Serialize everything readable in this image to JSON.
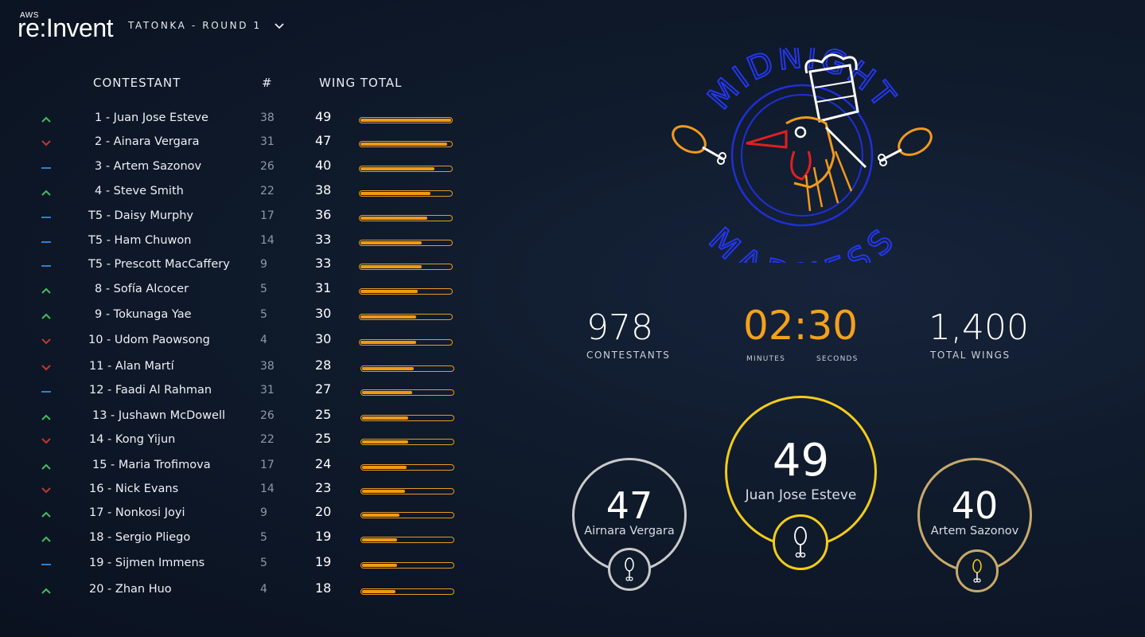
{
  "header": {
    "brand_small": "AWS",
    "brand_main": "re:Invent",
    "round_title": "TATONKA - ROUND 1",
    "dropdown_icon": "chevron-down-icon"
  },
  "table": {
    "headers": {
      "contestant": "CONTESTANT",
      "number": "#",
      "wing_total": "WING TOTAL"
    },
    "max_wings": 49,
    "rows": [
      {
        "trend": "up",
        "name": "1 - Juan Jose Esteve",
        "num": "38",
        "total": "49",
        "value": 49
      },
      {
        "trend": "down",
        "name": "2 - Ainara Vergara",
        "num": "31",
        "total": "47",
        "value": 47
      },
      {
        "trend": "same",
        "name": "3 - Artem Sazonov",
        "num": "26",
        "total": "40",
        "value": 40
      },
      {
        "trend": "up",
        "name": "4 - Steve Smith",
        "num": "22",
        "total": "38",
        "value": 38
      },
      {
        "trend": "same",
        "name": "T5 - Daisy Murphy",
        "num": "17",
        "total": "36",
        "value": 36
      },
      {
        "trend": "same",
        "name": "T5 - Ham Chuwon",
        "num": "14",
        "total": "33",
        "value": 33
      },
      {
        "trend": "same",
        "name": "T5 - Prescott MacCaffery",
        "num": "9",
        "total": "33",
        "value": 33
      },
      {
        "trend": "up",
        "name": "8 - Sofía Alcocer",
        "num": "5",
        "total": "31",
        "value": 31
      },
      {
        "trend": "up",
        "name": "9 - Tokunaga Yae",
        "num": "5",
        "total": "30",
        "value": 30
      },
      {
        "trend": "down",
        "name": "10 - Udom Paowsong",
        "num": "4",
        "total": "30",
        "value": 30
      },
      {
        "trend": "down",
        "name": "11 - Alan Martí",
        "num": "38",
        "total": "28",
        "value": 28
      },
      {
        "trend": "same",
        "name": "12 - Faadi Al Rahman",
        "num": "31",
        "total": "27",
        "value": 27
      },
      {
        "trend": "up",
        "name": "13 - Jushawn McDowell",
        "num": "26",
        "total": "25",
        "value": 25
      },
      {
        "trend": "down",
        "name": "14 - Kong Yijun",
        "num": "22",
        "total": "25",
        "value": 25
      },
      {
        "trend": "up",
        "name": "15 - Maria Trofimova",
        "num": "17",
        "total": "24",
        "value": 24
      },
      {
        "trend": "down",
        "name": "16 - Nick Evans",
        "num": "14",
        "total": "23",
        "value": 23
      },
      {
        "trend": "up",
        "name": "17 - Nonkosi Joyi",
        "num": "9",
        "total": "20",
        "value": 20
      },
      {
        "trend": "up",
        "name": "18 - Sergio Pliego",
        "num": "5",
        "total": "19",
        "value": 19
      },
      {
        "trend": "same",
        "name": "19 - Sijmen Immens",
        "num": "5",
        "total": "19",
        "value": 19
      },
      {
        "trend": "up",
        "name": "20 - Zhan Huo",
        "num": "4",
        "total": "18",
        "value": 18
      }
    ]
  },
  "logo": {
    "top_text": "MIDNIGHT",
    "bottom_text": "MADNESS",
    "icon": "rooster-chef-neon-logo"
  },
  "stats": {
    "contestants_value": "978",
    "contestants_label": "CONTESTANTS",
    "timer_value": "02:30",
    "minutes_label": "MINUTES",
    "seconds_label": "SECONDS",
    "wings_value": "1,400",
    "wings_label": "TOTAL WINGS"
  },
  "podium": {
    "first": {
      "score": "49",
      "name": "Juan Jose Esteve",
      "color": "#f2cc1a"
    },
    "second": {
      "score": "47",
      "name": "Airnara Vergara",
      "color": "#c9c9c9"
    },
    "third": {
      "score": "40",
      "name": "Artem Sazonov",
      "color": "#c8a96a"
    }
  },
  "colors": {
    "up": "#3fbf5c",
    "down": "#c0392b",
    "same": "#2f7fd1",
    "bar": "#f19a12",
    "accent": "#f4a11a"
  }
}
